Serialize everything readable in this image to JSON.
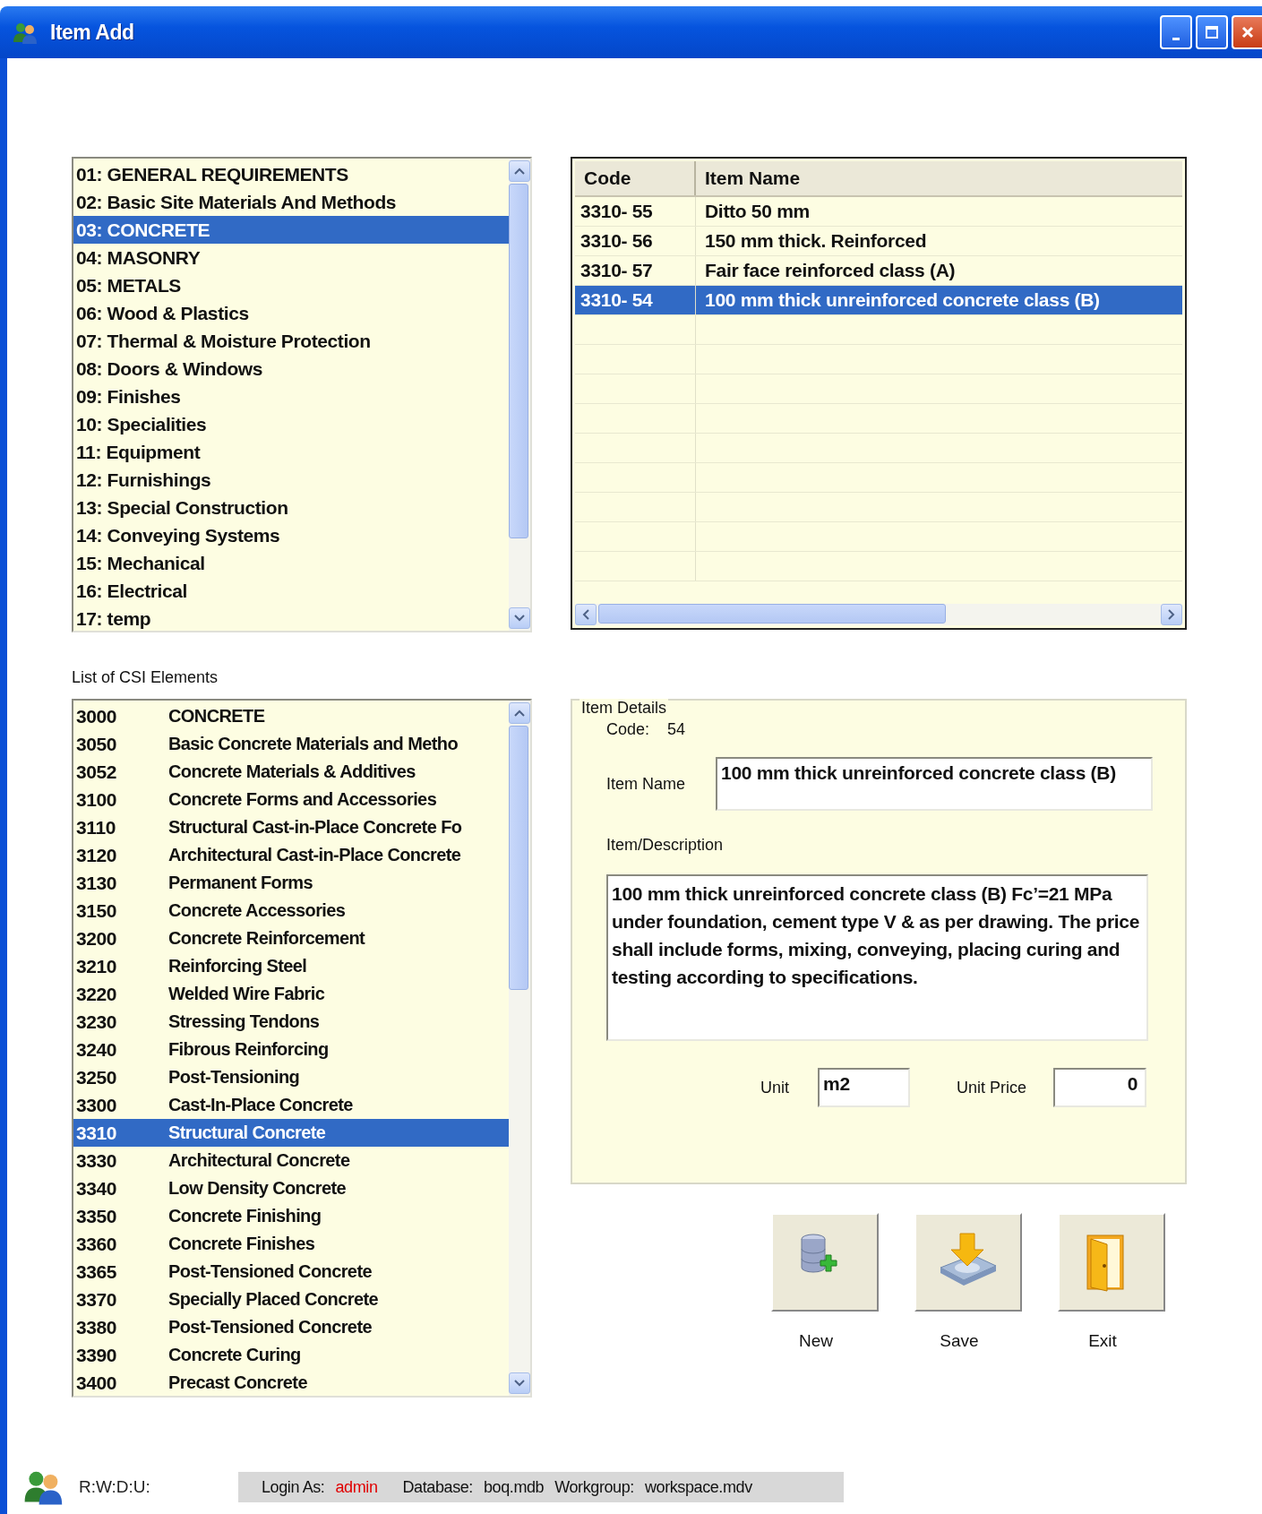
{
  "window": {
    "title": "Item Add"
  },
  "divisions": [
    {
      "label": "01: GENERAL REQUIREMENTS",
      "selected": false
    },
    {
      "label": "02: Basic Site Materials And Methods",
      "selected": false
    },
    {
      "label": "03: CONCRETE",
      "selected": true
    },
    {
      "label": "04: MASONRY",
      "selected": false
    },
    {
      "label": "05: METALS",
      "selected": false
    },
    {
      "label": "06: Wood & Plastics",
      "selected": false
    },
    {
      "label": "07: Thermal & Moisture Protection",
      "selected": false
    },
    {
      "label": "08: Doors & Windows",
      "selected": false
    },
    {
      "label": "09: Finishes",
      "selected": false
    },
    {
      "label": "10: Specialities",
      "selected": false
    },
    {
      "label": "11: Equipment",
      "selected": false
    },
    {
      "label": "12: Furnishings",
      "selected": false
    },
    {
      "label": "13: Special Construction",
      "selected": false
    },
    {
      "label": "14: Conveying Systems",
      "selected": false
    },
    {
      "label": "15: Mechanical",
      "selected": false
    },
    {
      "label": "16: Electrical",
      "selected": false
    },
    {
      "label": "17: temp",
      "selected": false
    }
  ],
  "items_table": {
    "columns": [
      "Code",
      "Item Name"
    ],
    "rows": [
      {
        "code": "3310- 55",
        "name": "Ditto 50 mm",
        "selected": false
      },
      {
        "code": "3310- 56",
        "name": "150 mm thick. Reinforced",
        "selected": false
      },
      {
        "code": "3310- 57",
        "name": "Fair face reinforced class (A)",
        "selected": false
      },
      {
        "code": "3310- 54",
        "name": "100 mm thick unreinforced concrete class (B)",
        "selected": true
      }
    ]
  },
  "elements_label": "List of CSI Elements",
  "elements": [
    {
      "code": "3000",
      "name": "CONCRETE",
      "selected": false
    },
    {
      "code": "3050",
      "name": "Basic Concrete Materials and Metho",
      "selected": false
    },
    {
      "code": "3052",
      "name": "Concrete Materials & Additives",
      "selected": false
    },
    {
      "code": "3100",
      "name": "Concrete Forms and Accessories",
      "selected": false
    },
    {
      "code": "3110",
      "name": "Structural Cast-in-Place Concrete Fo",
      "selected": false
    },
    {
      "code": "3120",
      "name": "Architectural Cast-in-Place Concrete",
      "selected": false
    },
    {
      "code": "3130",
      "name": "Permanent Forms",
      "selected": false
    },
    {
      "code": "3150",
      "name": "Concrete Accessories",
      "selected": false
    },
    {
      "code": "3200",
      "name": "Concrete Reinforcement",
      "selected": false
    },
    {
      "code": "3210",
      "name": "Reinforcing Steel",
      "selected": false
    },
    {
      "code": "3220",
      "name": "Welded Wire Fabric",
      "selected": false
    },
    {
      "code": "3230",
      "name": "Stressing Tendons",
      "selected": false
    },
    {
      "code": "3240",
      "name": "Fibrous Reinforcing",
      "selected": false
    },
    {
      "code": "3250",
      "name": "Post-Tensioning",
      "selected": false
    },
    {
      "code": "3300",
      "name": "Cast-In-Place Concrete",
      "selected": false
    },
    {
      "code": "3310",
      "name": "Structural Concrete",
      "selected": true
    },
    {
      "code": "3330",
      "name": "Architectural Concrete",
      "selected": false
    },
    {
      "code": "3340",
      "name": "Low Density Concrete",
      "selected": false
    },
    {
      "code": "3350",
      "name": "Concrete Finishing",
      "selected": false
    },
    {
      "code": "3360",
      "name": "Concrete Finishes",
      "selected": false
    },
    {
      "code": "3365",
      "name": "Post-Tensioned Concrete",
      "selected": false
    },
    {
      "code": "3370",
      "name": "Specially Placed Concrete",
      "selected": false
    },
    {
      "code": "3380",
      "name": "Post-Tensioned Concrete",
      "selected": false
    },
    {
      "code": "3390",
      "name": "Concrete Curing",
      "selected": false
    },
    {
      "code": "3400",
      "name": "Precast Concrete",
      "selected": false
    }
  ],
  "item_details": {
    "legend": "Item Details",
    "code_label": "Code:",
    "code": "54",
    "name_label": "Item Name",
    "name": "100 mm thick unreinforced concrete class (B)",
    "description_label": "Item/Description",
    "description": "100 mm thick unreinforced concrete class (B) Fc’=21 MPa under foundation, cement type V & as per drawing. The price shall include forms, mixing, conveying, placing curing and testing according to specifications.",
    "unit_label": "Unit",
    "unit": "m2",
    "price_label": "Unit Price",
    "price": "0"
  },
  "buttons": [
    {
      "kind": "new",
      "label": "New"
    },
    {
      "kind": "save",
      "label": "Save"
    },
    {
      "kind": "exit",
      "label": "Exit"
    }
  ],
  "status_bar": {
    "permissions": "R:W:D:U:",
    "login_label": "Login As:",
    "login": "admin",
    "database_label": "Database:",
    "database": "boq.mdb",
    "workgroup_label": "Workgroup:",
    "workgroup": "workspace.mdv"
  }
}
